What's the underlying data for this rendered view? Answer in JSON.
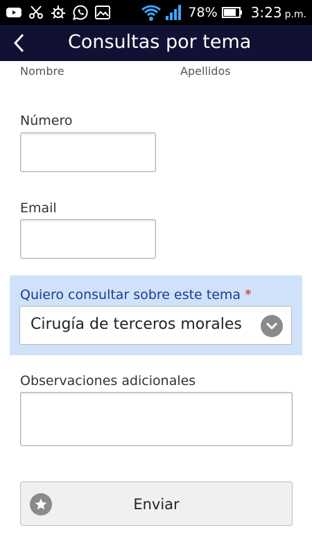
{
  "status_bar": {
    "icons": [
      "youtube-icon",
      "scissors-icon",
      "bug-icon",
      "whatsapp-icon",
      "gallery-icon",
      "wifi-icon",
      "signal-icon",
      "battery-icon"
    ],
    "battery": "78%",
    "time": "3:23",
    "ampm": "p.m."
  },
  "header": {
    "title": "Consultas por tema",
    "back_icon": "chevron-left-icon"
  },
  "form": {
    "nombre_label": "Nombre",
    "apellidos_label": "Apellidos",
    "numero_label": "Número",
    "numero_value": "",
    "email_label": "Email",
    "email_value": "",
    "topic_label": "Quiero consultar sobre este tema",
    "topic_required": "*",
    "topic_value": "Cirugía de terceros morales",
    "observaciones_label": "Observaciones adicionales",
    "observaciones_value": "",
    "submit_label": "Enviar"
  },
  "colors": {
    "status_bar": "#000000",
    "app_bar": "#111233",
    "highlight_panel": "#cfe2fa",
    "topic_label": "#1a3d8f",
    "required": "#d41e1e",
    "wifi": "#3ea6ff"
  }
}
